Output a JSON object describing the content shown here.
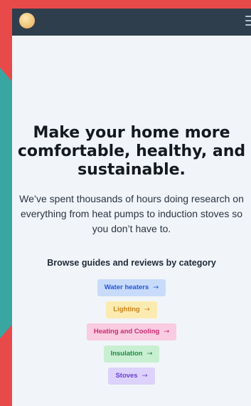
{
  "colors": {
    "background": "#e84a4a",
    "accent_teal": "#3aa6a2",
    "topbar": "#2f3e4c",
    "page": "#f1f5f9"
  },
  "header": {
    "avatar_icon": "avatar-circle",
    "menu_icon": "hamburger-menu-icon"
  },
  "hero": {
    "headline": "Make your home more comfortable, healthy, and sustainable.",
    "subtitle": "We’ve spent thousands of hours doing research on everything from heat pumps to induction stoves so you don’t have to."
  },
  "browse": {
    "heading": "Browse guides and reviews by category",
    "categories": [
      {
        "label": "Water heaters",
        "arrow": "→",
        "color": "#2456d6"
      },
      {
        "label": "Lighting",
        "arrow": "→",
        "color": "#c9821a"
      },
      {
        "label": "Heating and Cooling",
        "arrow": "→",
        "color": "#cc2a73"
      },
      {
        "label": "Insulation",
        "arrow": "→",
        "color": "#1f8a44"
      },
      {
        "label": "Stoves",
        "arrow": "→",
        "color": "#6b3fd6"
      }
    ]
  }
}
